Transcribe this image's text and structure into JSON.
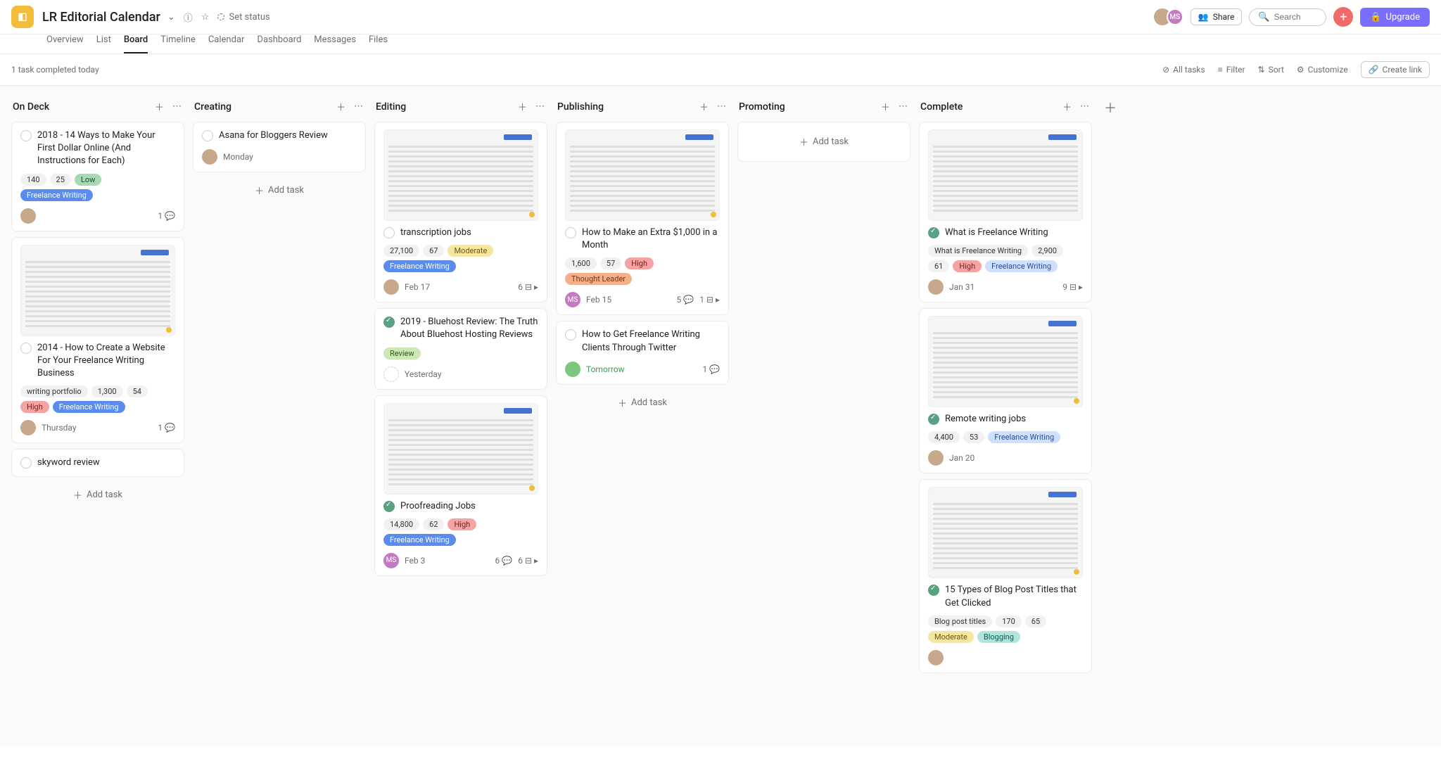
{
  "header": {
    "project_title": "LR Editorial Calendar",
    "set_status": "Set status",
    "share": "Share",
    "search_placeholder": "Search",
    "upgrade": "Upgrade",
    "members": [
      {
        "initials": "",
        "cls": "avatar-1"
      },
      {
        "initials": "MS",
        "cls": "avatar-2"
      }
    ]
  },
  "tabs": [
    "Overview",
    "List",
    "Board",
    "Timeline",
    "Calendar",
    "Dashboard",
    "Messages",
    "Files"
  ],
  "active_tab": "Board",
  "toolbar": {
    "completed_text": "1 task completed today",
    "all_tasks": "All tasks",
    "filter": "Filter",
    "sort": "Sort",
    "customize": "Customize",
    "create_link": "Create link"
  },
  "add_task_label": "Add task",
  "columns": [
    {
      "title": "On Deck",
      "cards": [
        {
          "title": "2018 - 14 Ways to Make Your First Dollar Online (And Instructions for Each)",
          "tags": [
            {
              "text": "140",
              "cls": ""
            },
            {
              "text": "25",
              "cls": ""
            },
            {
              "text": "Low",
              "cls": "tag-low"
            },
            {
              "text": "Freelance Writing",
              "cls": "tag-fw"
            }
          ],
          "avatar_cls": "avatar-1",
          "date": "",
          "comments": "1",
          "subtasks": ""
        },
        {
          "thumb": true,
          "thumb_dot": "#f1bd3b",
          "title": "2014 - How to Create a Website For Your Freelance Writing Business",
          "tags": [
            {
              "text": "writing portfolio",
              "cls": ""
            },
            {
              "text": "1,300",
              "cls": ""
            },
            {
              "text": "54",
              "cls": ""
            },
            {
              "text": "High",
              "cls": "tag-high"
            },
            {
              "text": "Freelance Writing",
              "cls": "tag-fw"
            }
          ],
          "avatar_cls": "avatar-1",
          "date": "Thursday",
          "comments": "1",
          "subtasks": ""
        },
        {
          "title": "skyword review",
          "tags": [],
          "no_footer": true
        }
      ],
      "show_add_task_bottom": true
    },
    {
      "title": "Creating",
      "cards": [
        {
          "title": "Asana for Bloggers Review",
          "tags": [],
          "avatar_cls": "avatar-1",
          "date": "Monday",
          "comments": "",
          "subtasks": ""
        }
      ],
      "show_add_task_bottom": true
    },
    {
      "title": "Editing",
      "cards": [
        {
          "thumb": true,
          "thumb_dot": "#f1bd3b",
          "title": "transcription jobs",
          "tags": [
            {
              "text": "27,100",
              "cls": ""
            },
            {
              "text": "67",
              "cls": ""
            },
            {
              "text": "Moderate",
              "cls": "tag-moderate"
            },
            {
              "text": "Freelance Writing",
              "cls": "tag-fw"
            }
          ],
          "avatar_cls": "avatar-1",
          "date": "Feb 17",
          "comments": "",
          "subtasks": "6",
          "subtask_arrow": true
        },
        {
          "done": true,
          "title": "2019 - Bluehost Review: The Truth About Bluehost Hosting Reviews",
          "tags": [
            {
              "text": "Review",
              "cls": "tag-review"
            }
          ],
          "avatar_cls": "avatar-empty",
          "avatar_empty": true,
          "date": "Yesterday",
          "comments": "",
          "subtasks": ""
        },
        {
          "thumb": true,
          "thumb_dot": "#f1bd3b",
          "done": true,
          "title": "Proofreading Jobs",
          "tags": [
            {
              "text": "14,800",
              "cls": ""
            },
            {
              "text": "62",
              "cls": ""
            },
            {
              "text": "High",
              "cls": "tag-high"
            },
            {
              "text": "Freelance Writing",
              "cls": "tag-fw"
            }
          ],
          "avatar_cls": "avatar-2",
          "avatar_initials": "MS",
          "date": "Feb 3",
          "comments": "6",
          "subtasks": "6",
          "subtask_arrow": true
        }
      ]
    },
    {
      "title": "Publishing",
      "cards": [
        {
          "thumb": true,
          "thumb_dot": "#f1bd3b",
          "title": "How to Make an Extra $1,000 in a Month",
          "tags": [
            {
              "text": "1,600",
              "cls": ""
            },
            {
              "text": "57",
              "cls": ""
            },
            {
              "text": "High",
              "cls": "tag-high"
            },
            {
              "text": "Thought Leader",
              "cls": "tag-thought"
            }
          ],
          "avatar_cls": "avatar-2",
          "avatar_initials": "MS",
          "date": "Feb 15",
          "comments": "5",
          "subtasks": "1",
          "subtask_arrow": true
        },
        {
          "title": "How to Get Freelance Writing Clients Through Twitter",
          "tags": [],
          "avatar_cls": "avatar-3",
          "date": "Tomorrow",
          "date_green": true,
          "comments": "1",
          "subtasks": ""
        }
      ],
      "show_add_task_bottom": true
    },
    {
      "title": "Promoting",
      "empty_add_card": true
    },
    {
      "title": "Complete",
      "cards": [
        {
          "thumb": true,
          "done": true,
          "title": "What is Freelance Writing",
          "tags": [
            {
              "text": "What is Freelance Writing",
              "cls": ""
            },
            {
              "text": "2,900",
              "cls": ""
            },
            {
              "text": "61",
              "cls": ""
            },
            {
              "text": "High",
              "cls": "tag-high"
            },
            {
              "text": "Freelance Writing",
              "cls": "tag-fw-light"
            }
          ],
          "avatar_cls": "avatar-1",
          "date": "Jan 31",
          "comments": "",
          "subtasks": "9",
          "subtask_arrow": true
        },
        {
          "thumb": true,
          "thumb_dot": "#f1bd3b",
          "done": true,
          "title": "Remote writing jobs",
          "tags": [
            {
              "text": "4,400",
              "cls": ""
            },
            {
              "text": "53",
              "cls": ""
            },
            {
              "text": "Freelance Writing",
              "cls": "tag-fw-light"
            }
          ],
          "avatar_cls": "avatar-1",
          "date": "Jan 20",
          "comments": "",
          "subtasks": ""
        },
        {
          "thumb": true,
          "thumb_dot": "#f1bd3b",
          "done": true,
          "title": "15 Types of Blog Post Titles that Get Clicked",
          "tags": [
            {
              "text": "Blog post titles",
              "cls": ""
            },
            {
              "text": "170",
              "cls": ""
            },
            {
              "text": "65",
              "cls": ""
            },
            {
              "text": "Moderate",
              "cls": "tag-moderate"
            },
            {
              "text": "Blogging",
              "cls": "tag-blog"
            }
          ],
          "avatar_cls": "avatar-1",
          "date": "",
          "comments": "",
          "subtasks": ""
        }
      ]
    }
  ]
}
